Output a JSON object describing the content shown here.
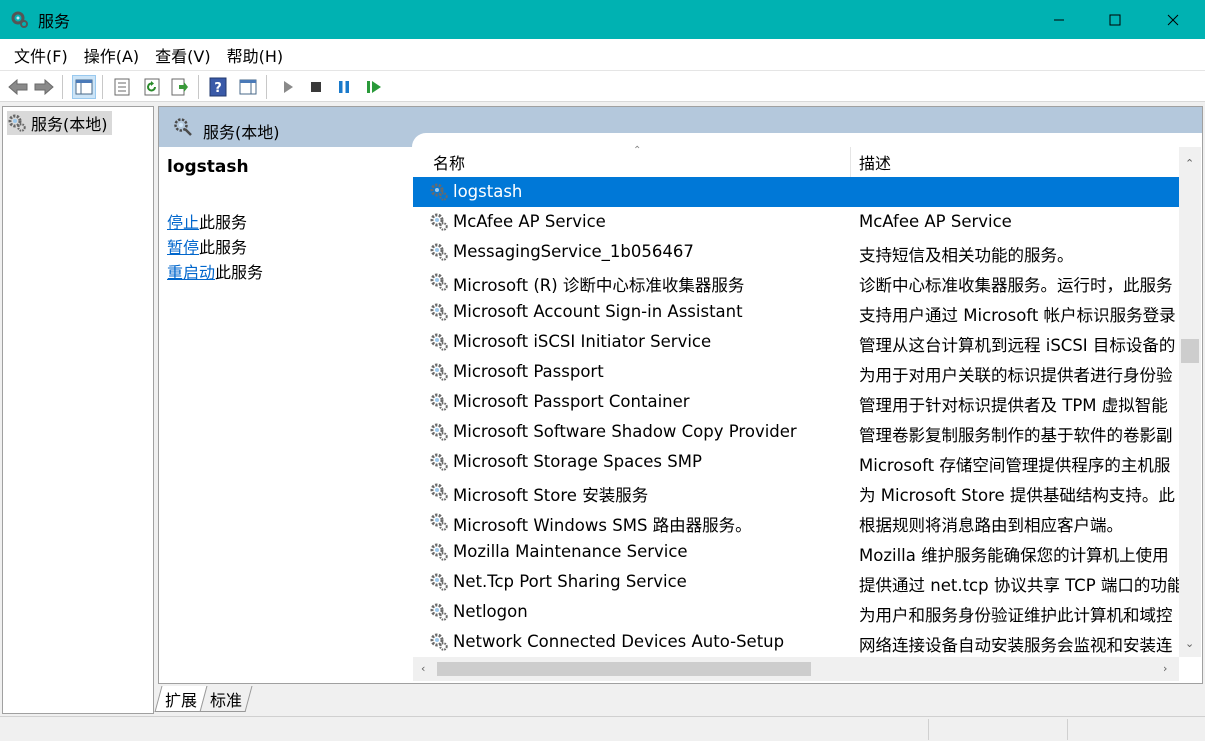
{
  "window": {
    "title": "服务",
    "app_icon": "gear-icon"
  },
  "menu": [
    "文件(F)",
    "操作(A)",
    "查看(V)",
    "帮助(H)"
  ],
  "tree": {
    "root_label": "服务(本地)"
  },
  "main": {
    "header_title": "服务(本地)",
    "selected_service": "logstash",
    "actions": [
      {
        "link": "停止",
        "suffix": "此服务"
      },
      {
        "link": "暂停",
        "suffix": "此服务"
      },
      {
        "link": "重启动",
        "suffix": "此服务"
      }
    ],
    "columns": {
      "name": "名称",
      "description": "描述"
    },
    "rows": [
      {
        "name": "logstash",
        "description": ""
      },
      {
        "name": "McAfee AP Service",
        "description": "McAfee AP Service"
      },
      {
        "name": "MessagingService_1b056467",
        "description": "支持短信及相关功能的服务。"
      },
      {
        "name": "Microsoft (R) 诊断中心标准收集器服务",
        "description": "诊断中心标准收集器服务。运行时，此服务"
      },
      {
        "name": "Microsoft Account Sign-in Assistant",
        "description": "支持用户通过 Microsoft 帐户标识服务登录"
      },
      {
        "name": "Microsoft iSCSI Initiator Service",
        "description": "管理从这台计算机到远程 iSCSI 目标设备的"
      },
      {
        "name": "Microsoft Passport",
        "description": "为用于对用户关联的标识提供者进行身份验"
      },
      {
        "name": "Microsoft Passport Container",
        "description": "管理用于针对标识提供者及 TPM 虚拟智能"
      },
      {
        "name": "Microsoft Software Shadow Copy Provider",
        "description": "管理卷影复制服务制作的基于软件的卷影副"
      },
      {
        "name": "Microsoft Storage Spaces SMP",
        "description": "Microsoft 存储空间管理提供程序的主机服"
      },
      {
        "name": "Microsoft Store 安装服务",
        "description": "为 Microsoft Store 提供基础结构支持。此"
      },
      {
        "name": "Microsoft Windows SMS 路由器服务。",
        "description": "根据规则将消息路由到相应客户端。"
      },
      {
        "name": "Mozilla Maintenance Service",
        "description": "Mozilla 维护服务能确保您的计算机上使用"
      },
      {
        "name": "Net.Tcp Port Sharing Service",
        "description": "提供通过 net.tcp 协议共享 TCP 端口的功能"
      },
      {
        "name": "Netlogon",
        "description": "为用户和服务身份验证维护此计算机和域控"
      },
      {
        "name": "Network Connected Devices Auto-Setup",
        "description": "网络连接设备自动安装服务会监视和安装连"
      }
    ]
  },
  "tabs": [
    "扩展",
    "标准"
  ],
  "colors": {
    "titlebar": "#00b2b2",
    "selection": "#0078d7",
    "link": "#0066cc",
    "header": "#b4c8dc"
  }
}
